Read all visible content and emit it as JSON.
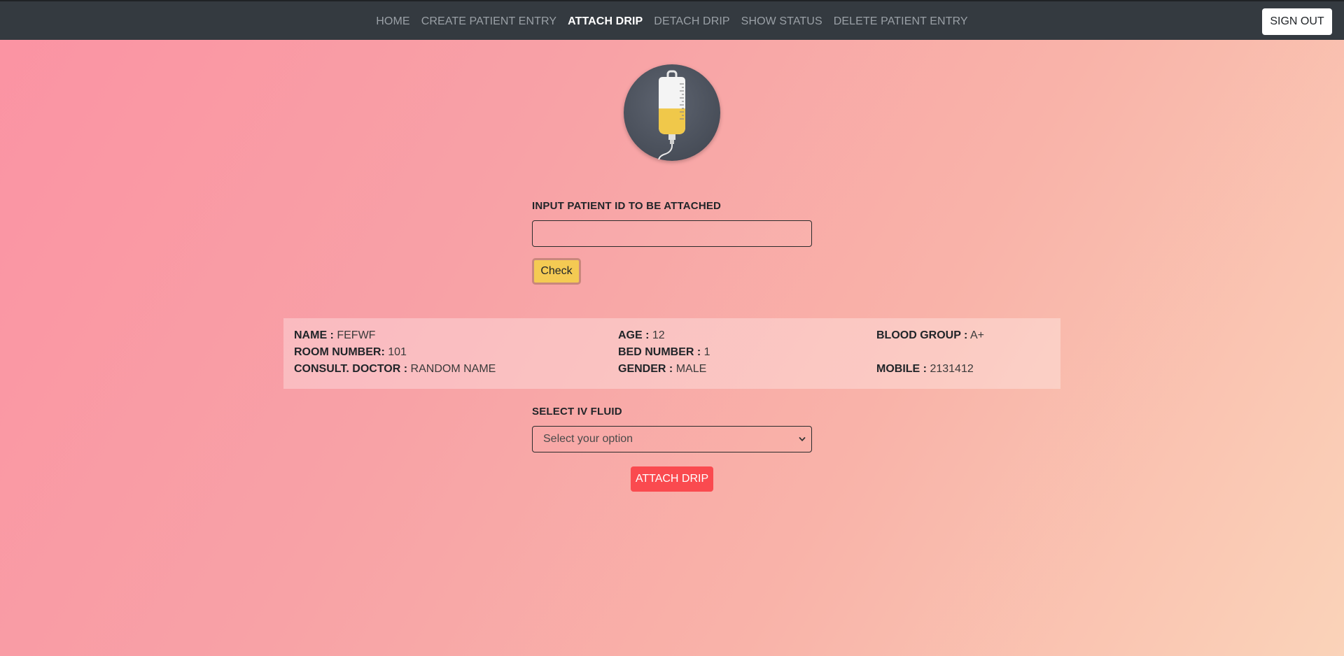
{
  "nav": {
    "links": [
      "HOME",
      "CREATE PATIENT ENTRY",
      "ATTACH DRIP",
      "DETACH DRIP",
      "SHOW STATUS",
      "DELETE PATIENT ENTRY"
    ],
    "active": "ATTACH DRIP",
    "signout_label": "SIGN OUT"
  },
  "logo": {
    "icon": "iv-drip-bag-icon",
    "fill_level": 0.45,
    "colors": {
      "circle": "#4b515c",
      "fluid": "#f0c84a"
    }
  },
  "patient_id": {
    "label": "INPUT PATIENT ID TO BE ATTACHED",
    "value": "",
    "check_label": "Check"
  },
  "details": {
    "name": {
      "key": "NAME :",
      "value": "FEFWF"
    },
    "age": {
      "key": "AGE :",
      "value": "12"
    },
    "blood_group": {
      "key": "BLOOD GROUP :",
      "value": "A+"
    },
    "room_number": {
      "key": "ROOM NUMBER:",
      "value": "101"
    },
    "bed_number": {
      "key": "BED NUMBER :",
      "value": "1"
    },
    "consult_doctor": {
      "key": "CONSULT. DOCTOR :",
      "value": "RANDOM NAME"
    },
    "gender": {
      "key": "GENDER :",
      "value": "MALE"
    },
    "mobile": {
      "key": "MOBILE :",
      "value": "2131412"
    }
  },
  "iv_fluid": {
    "label": "SELECT IV FLUID",
    "selected": "Select your option"
  },
  "attach_label": "ATTACH DRIP",
  "colors": {
    "navbar": "#343a40",
    "check_button": "#f4ca53",
    "attach_button": "#fa4a4f"
  }
}
